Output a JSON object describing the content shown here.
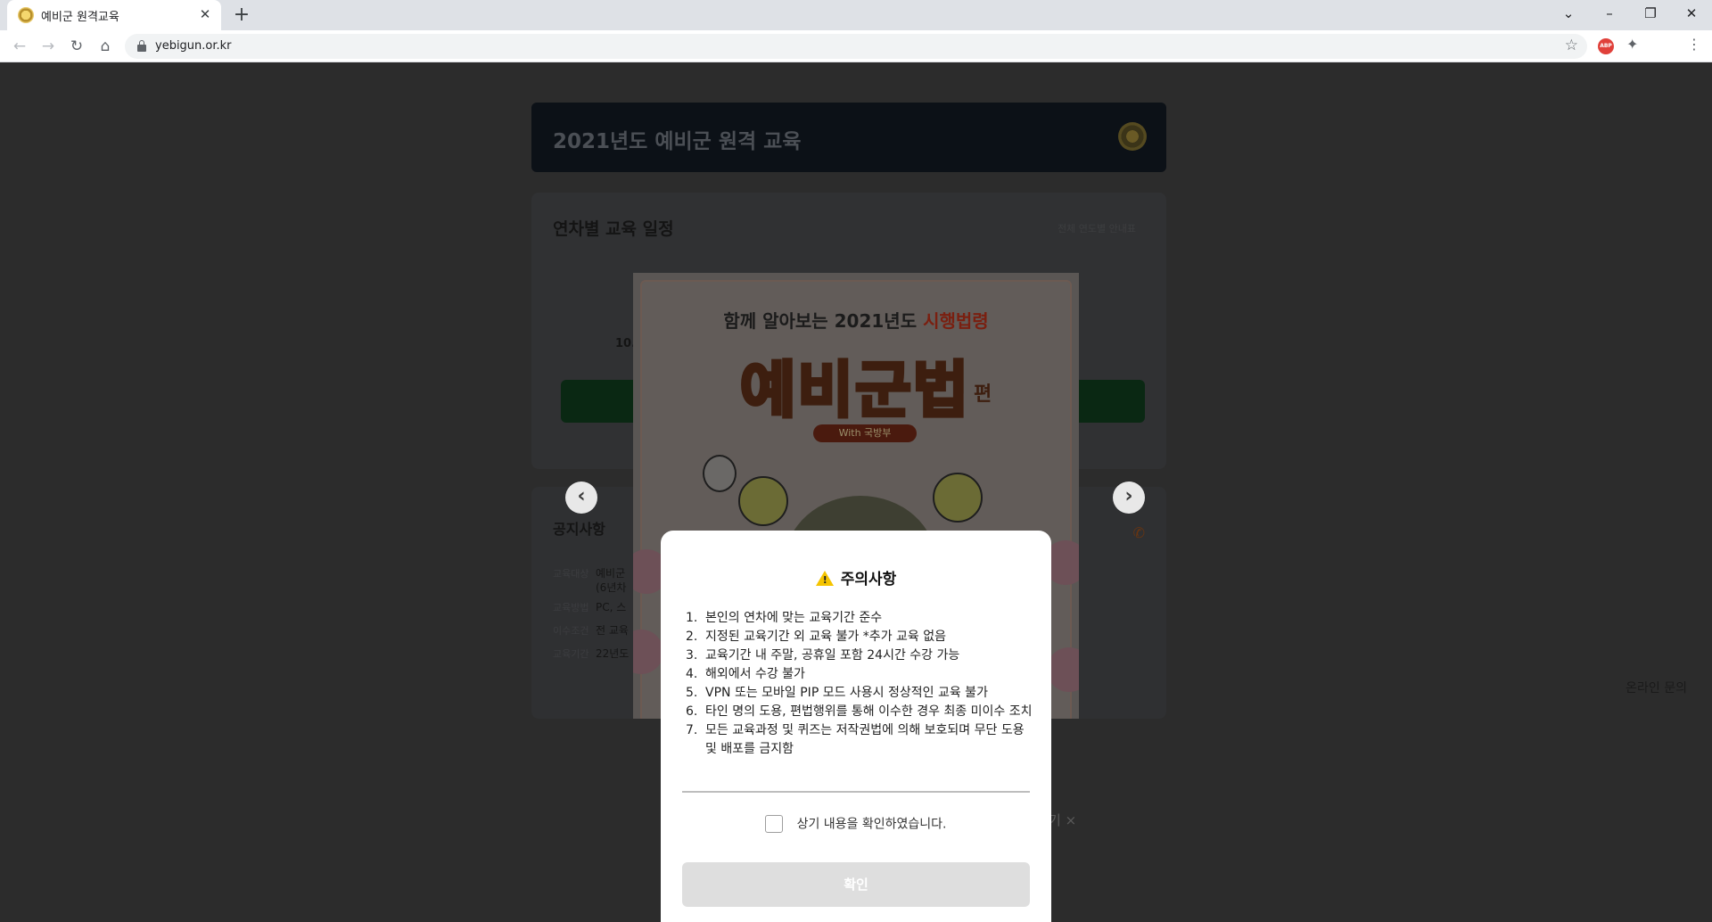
{
  "browser": {
    "tab_title": "예비군 원격교육",
    "new_tab_label": "+",
    "url": "yebigun.or.kr",
    "window_controls": [
      "⌄",
      "–",
      "❐",
      "✕"
    ]
  },
  "hero": {
    "title": "2021년도 예비군 원격 교육"
  },
  "schedule": {
    "title": "연차별 교육 일정",
    "link": "전체 연도별 안내표",
    "date_partial": "10."
  },
  "notice": {
    "title": "공지사항",
    "rows": [
      {
        "key": "교육대상",
        "value": "예비군"
      },
      {
        "key": "",
        "value": "(6년차"
      },
      {
        "key": "교육방법",
        "value": "PC, 스"
      },
      {
        "key": "이수조건",
        "value": "전 교육"
      },
      {
        "key": "교육기간",
        "value": "22년도"
      }
    ],
    "inquiry": "온라인 문의"
  },
  "popup": {
    "subtitle_prefix": "함께 알아보는 2021년도 ",
    "subtitle_highlight": "시행법령",
    "big_title": "예비군법",
    "suffix": "편",
    "with": "With 국방부",
    "close_today_tail": "기",
    "close_icon": "×",
    "prev_icon": "‹",
    "next_icon": "›"
  },
  "dialog": {
    "title": "주의사항",
    "rules": [
      {
        "num": "1.",
        "text": "본인의 연차에 맞는 교육기간 준수"
      },
      {
        "num": "2.",
        "text": "지정된 교육기간 외 교육 불가 *추가 교육 없음"
      },
      {
        "num": "3.",
        "text": "교육기간 내 주말, 공휴일 포함 24시간 수강 가능"
      },
      {
        "num": "4.",
        "text": "해외에서 수강 불가"
      },
      {
        "num": "5.",
        "text": "VPN 또는 모바일 PIP 모드 사용시 정상적인 교육 불가"
      },
      {
        "num": "6.",
        "text": "타인 명의 도용, 편법행위를 통해 이수한 경우 최종 미이수 조치"
      },
      {
        "num": "7.",
        "text": "모든 교육과정 및 퀴즈는 저작권법에 의해 보호되며 무단 도용 및 배포를 금지함"
      }
    ],
    "checkbox_label": "상기 내용을 확인하였습니다.",
    "confirm_label": "확인"
  }
}
